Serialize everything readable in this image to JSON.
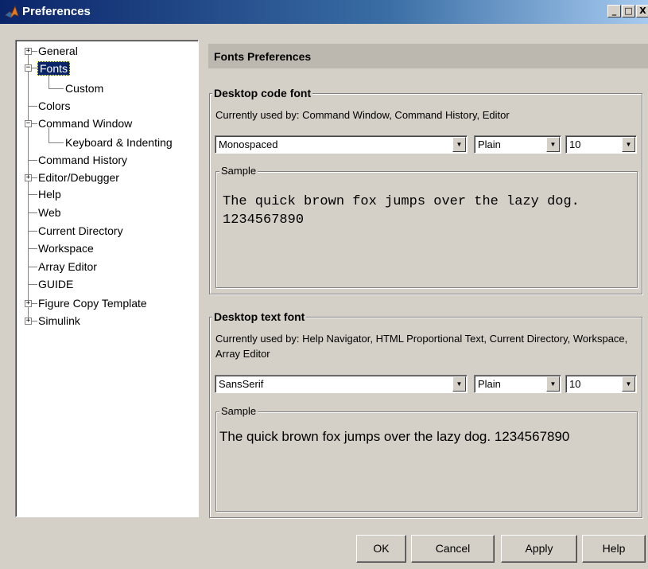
{
  "window": {
    "title": "Preferences",
    "controls": {
      "minimize": "_",
      "maximize": "□",
      "close": "X"
    }
  },
  "tree": {
    "nodes": [
      {
        "label": "General",
        "expander": "+"
      },
      {
        "label": "Fonts",
        "expander": "−",
        "selected": true
      },
      {
        "label": "Custom"
      },
      {
        "label": "Colors"
      },
      {
        "label": "Command Window",
        "expander": "−"
      },
      {
        "label": "Keyboard & Indenting"
      },
      {
        "label": "Command History"
      },
      {
        "label": "Editor/Debugger",
        "expander": "+"
      },
      {
        "label": "Help"
      },
      {
        "label": "Web"
      },
      {
        "label": "Current Directory"
      },
      {
        "label": "Workspace"
      },
      {
        "label": "Array Editor"
      },
      {
        "label": "GUIDE"
      },
      {
        "label": "Figure Copy Template",
        "expander": "+"
      },
      {
        "label": "Simulink",
        "expander": "+"
      }
    ]
  },
  "panel": {
    "title": "Fonts Preferences",
    "code_font": {
      "legend": "Desktop code font",
      "description": "Currently used by: Command Window, Command History, Editor",
      "family": "Monospaced",
      "style": "Plain",
      "size": "10",
      "sample_label": "Sample",
      "sample_text": "The quick brown fox jumps over the lazy dog.  1234567890"
    },
    "text_font": {
      "legend": "Desktop text font",
      "description": "Currently used by: Help Navigator, HTML Proportional Text, Current Directory, Workspace, Array Editor",
      "family": "SansSerif",
      "style": "Plain",
      "size": "10",
      "sample_label": "Sample",
      "sample_text": "The quick brown fox jumps over the lazy dog.  1234567890"
    }
  },
  "buttons": {
    "ok": "OK",
    "cancel": "Cancel",
    "apply": "Apply",
    "help": "Help"
  },
  "colors": {
    "titlebar_start": "#0a246a",
    "titlebar_end": "#a6caf0",
    "face": "#d4d0c8",
    "selection": "#0a246a"
  }
}
